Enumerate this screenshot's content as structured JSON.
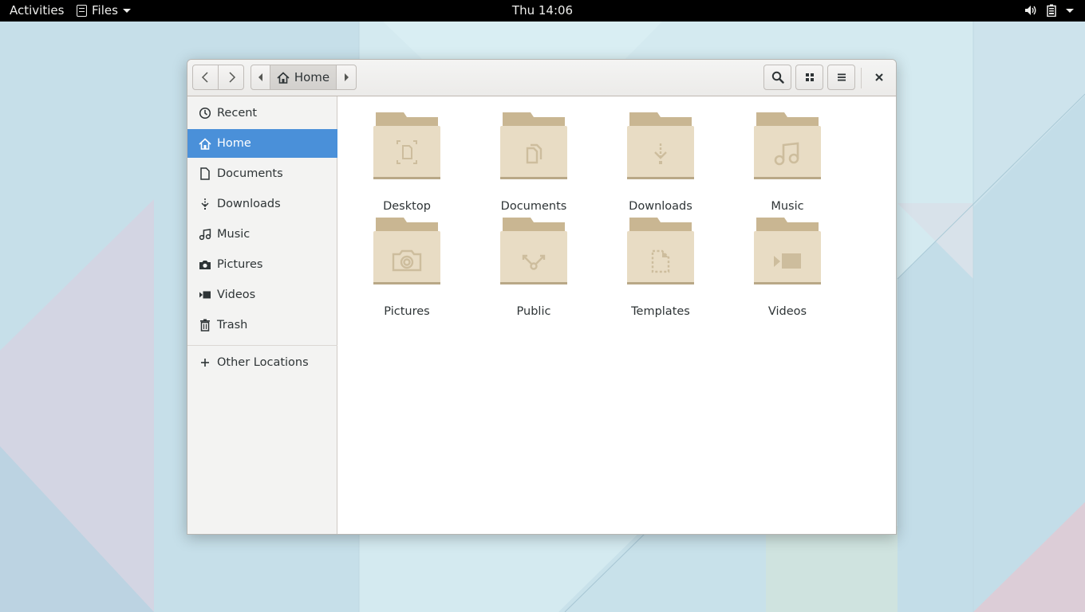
{
  "topbar": {
    "activities": "Activities",
    "app_name": "Files",
    "clock": "Thu 14:06",
    "icons": [
      "volume-icon",
      "battery-icon",
      "system-menu-arrow-icon"
    ]
  },
  "window": {
    "path_button": "Home",
    "icons": {
      "back": "chevron-left-icon",
      "forward": "chevron-right-icon",
      "search": "search-icon",
      "view": "grid-view-icon",
      "menu": "hamburger-menu-icon",
      "close": "close-icon"
    }
  },
  "sidebar": {
    "items": [
      {
        "label": "Recent",
        "icon": "clock-icon",
        "selected": false
      },
      {
        "label": "Home",
        "icon": "home-icon",
        "selected": true
      },
      {
        "label": "Documents",
        "icon": "document-icon",
        "selected": false
      },
      {
        "label": "Downloads",
        "icon": "download-icon",
        "selected": false
      },
      {
        "label": "Music",
        "icon": "music-note-icon",
        "selected": false
      },
      {
        "label": "Pictures",
        "icon": "camera-icon",
        "selected": false
      },
      {
        "label": "Videos",
        "icon": "video-icon",
        "selected": false
      },
      {
        "label": "Trash",
        "icon": "trash-icon",
        "selected": false
      }
    ],
    "other_locations": "Other Locations"
  },
  "folders": [
    {
      "label": "Desktop",
      "icon": "desktop-folder-icon"
    },
    {
      "label": "Documents",
      "icon": "documents-folder-icon"
    },
    {
      "label": "Downloads",
      "icon": "downloads-folder-icon"
    },
    {
      "label": "Music",
      "icon": "music-folder-icon"
    },
    {
      "label": "Pictures",
      "icon": "pictures-folder-icon"
    },
    {
      "label": "Public",
      "icon": "public-folder-icon"
    },
    {
      "label": "Templates",
      "icon": "templates-folder-icon"
    },
    {
      "label": "Videos",
      "icon": "videos-folder-icon"
    }
  ],
  "colors": {
    "selection": "#4a90d9",
    "folder_body": "#e8dcc4",
    "folder_back": "#c9b692",
    "topbar": "#000000"
  }
}
